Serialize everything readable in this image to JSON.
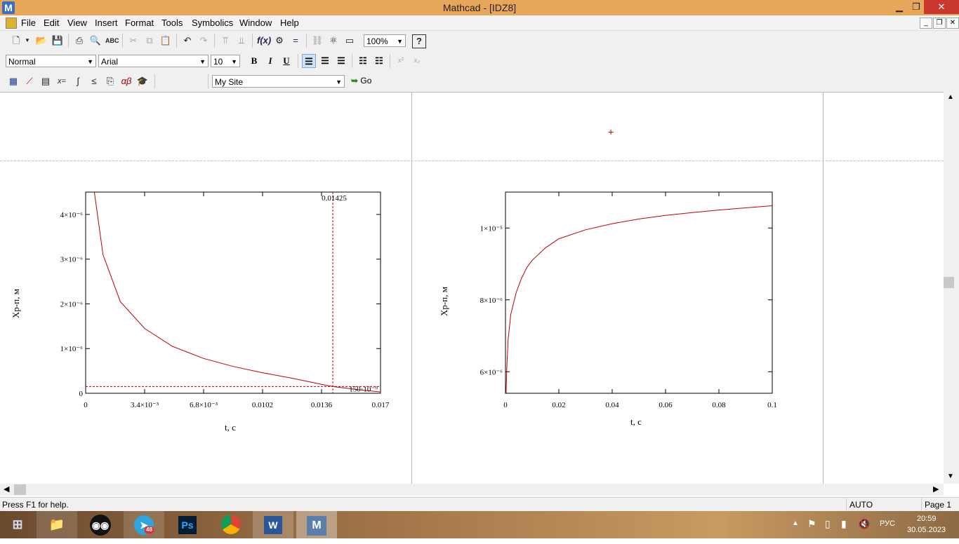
{
  "window": {
    "title": "Mathcad - [IDZ8]",
    "logo": "M"
  },
  "menu": [
    "File",
    "Edit",
    "View",
    "Insert",
    "Format",
    "Tools",
    "Symbolics",
    "Window",
    "Help"
  ],
  "toolbar_standard": {
    "zoom": "100%"
  },
  "toolbar_formatting": {
    "style": "Normal",
    "font": "Arial",
    "size": "10",
    "bold": "B",
    "italic": "I",
    "underline": "U",
    "superscript": "x²",
    "subscript": "x₂"
  },
  "toolbar_math": {
    "site": "My Site",
    "go": "Go"
  },
  "plot1": {
    "ylabel": "Xp-п, м",
    "xlabel": "t, c",
    "yticks": [
      "0",
      "1×10⁻⁶",
      "2×10⁻⁶",
      "3×10⁻⁶",
      "4×10⁻⁶"
    ],
    "xticks": [
      "0",
      "3.4×10⁻³",
      "6.8×10⁻³",
      "0.0102",
      "0.0136",
      "0.017"
    ],
    "marker_x_label": "0.01425",
    "marker_y_label": "150·10⁻⁹",
    "curve_color": "#c00000"
  },
  "plot2": {
    "ylabel": "Xp-п, м",
    "xlabel": "t, c",
    "yticks": [
      "6×10⁻⁶",
      "8×10⁻⁶",
      "1×10⁻⁵"
    ],
    "xticks": [
      "0",
      "0.02",
      "0.04",
      "0.06",
      "0.08",
      "0.1"
    ],
    "curve_color": "#c00000"
  },
  "chart_data": [
    {
      "type": "line",
      "xlabel": "t, c",
      "ylabel": "Xp-п, м",
      "xlim": [
        0,
        0.017
      ],
      "ylim": [
        0,
        4.5e-06
      ],
      "series": [
        {
          "x": [
            0.0005,
            0.001,
            0.002,
            0.0034,
            0.005,
            0.0068,
            0.0085,
            0.0102,
            0.012,
            0.0136,
            0.01425,
            0.0155,
            0.017
          ],
          "y": [
            4.5e-06,
            3.1e-06,
            2.05e-06,
            1.45e-06,
            1.05e-06,
            7.8e-07,
            6e-07,
            4.6e-07,
            3.3e-07,
            2e-07,
            1.5e-07,
            9e-08,
            3e-08
          ]
        }
      ],
      "markers": {
        "x": 0.01425,
        "y": 1.5e-07
      }
    },
    {
      "type": "line",
      "xlabel": "t, c",
      "ylabel": "Xp-п, м",
      "xlim": [
        0,
        0.1
      ],
      "ylim": [
        5.4e-06,
        1.1e-05
      ],
      "series": [
        {
          "x": [
            0.0002,
            0.0005,
            0.001,
            0.002,
            0.004,
            0.006,
            0.008,
            0.01,
            0.015,
            0.02,
            0.03,
            0.04,
            0.05,
            0.06,
            0.07,
            0.08,
            0.09,
            0.1
          ],
          "y": [
            5.4e-06,
            6.1e-06,
            6.9e-06,
            7.6e-06,
            8.2e-06,
            8.6e-06,
            8.9e-06,
            9.1e-06,
            9.45e-06,
            9.7e-06,
            9.95e-06,
            1.012e-05,
            1.025e-05,
            1.035e-05,
            1.043e-05,
            1.05e-05,
            1.056e-05,
            1.062e-05
          ]
        }
      ]
    }
  ],
  "status": {
    "help": "Press F1 for help.",
    "mode": "AUTO",
    "page": "Page 1"
  },
  "tray": {
    "lang": "РУС",
    "time": "20:59",
    "date": "30.05.2023",
    "telegram_badge": "48"
  }
}
